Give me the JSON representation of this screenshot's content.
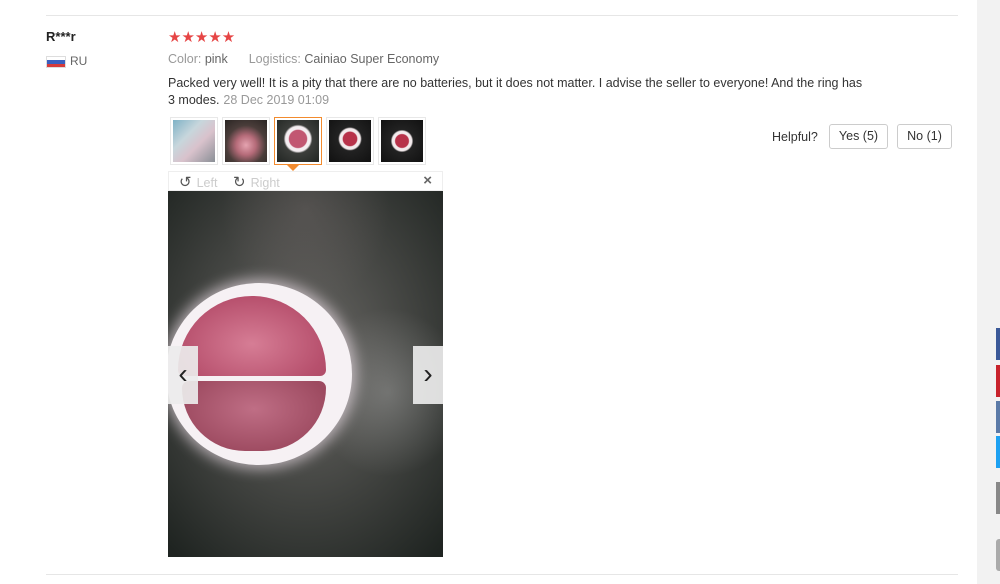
{
  "review": {
    "user_name": "R***r",
    "country": "RU",
    "stars": "★★★★★",
    "rating": 5,
    "color_label": "Color:",
    "color_value": "pink",
    "logistics_label": "Logistics:",
    "logistics_value": "Cainiao Super Economy",
    "text": "Packed very well! It is a pity that there are no batteries, but it does not matter. I advise the seller to everyone! And the ring has 3 modes.",
    "date": "28 Dec 2019 01:09"
  },
  "feedback": {
    "helpful_label": "Helpful?",
    "yes_label": "Yes (5)",
    "no_label": "No (1)"
  },
  "viewer": {
    "rotate_left_icon": "↺",
    "rotate_left_label": "Left",
    "rotate_right_icon": "↻",
    "rotate_right_label": "Right",
    "close_icon": "×",
    "prev_icon": "‹",
    "next_icon": "›"
  },
  "colors": {
    "star": "#e64545",
    "active_thumb": "#f28b2e"
  }
}
